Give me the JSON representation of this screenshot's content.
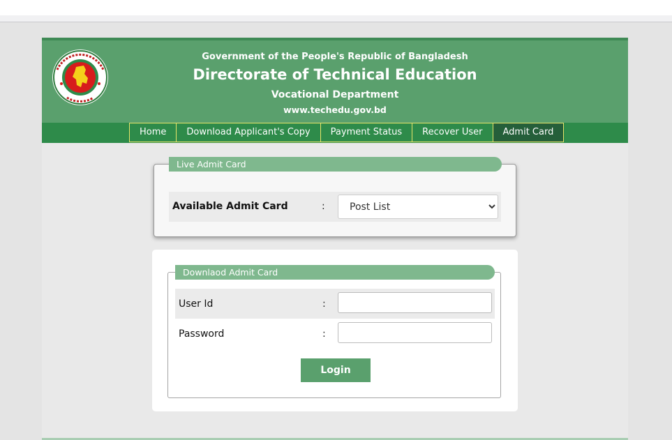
{
  "header": {
    "government": "Government of the People's Republic of Bangladesh",
    "directorate": "Directorate of Technical Education",
    "department": "Vocational Department",
    "website": "www.techedu.gov.bd",
    "logo_icon": "bangladesh-government-seal-icon"
  },
  "nav": {
    "items": [
      {
        "label": "Home"
      },
      {
        "label": "Download Applicant's Copy"
      },
      {
        "label": "Payment Status"
      },
      {
        "label": "Recover User"
      },
      {
        "label": "Admit Card",
        "active": true
      }
    ]
  },
  "live_admit": {
    "legend": "Live Admit Card",
    "label": "Available Admit Card",
    "colon": ":",
    "select_value": "Post List"
  },
  "download_admit": {
    "legend": "Downlaod Admit Card",
    "user_id_label": "User Id",
    "password_label": "Password",
    "colon": ":",
    "user_id_value": "",
    "password_value": "",
    "login_label": "Login"
  },
  "colors": {
    "header_green": "#5aa06d",
    "nav_green": "#2e8b4a",
    "nav_active": "#255f3a",
    "nav_border": "#e9e56a",
    "legend_green": "#7fb88e"
  }
}
